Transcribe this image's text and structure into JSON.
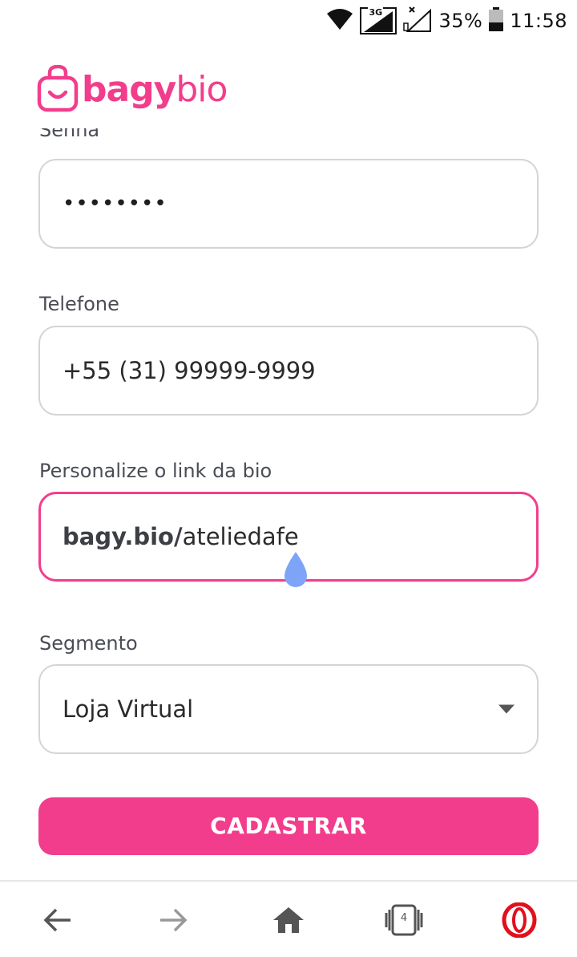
{
  "status_bar": {
    "network_label": "3G",
    "battery_percent": "35%",
    "time": "11:58",
    "icons": [
      "wifi-icon",
      "signal-icon",
      "no-signal-icon",
      "battery-icon"
    ]
  },
  "header": {
    "logo_bagy": "bagy",
    "logo_bio": "bio",
    "brand_color": "#f23d8c"
  },
  "form": {
    "password": {
      "label": "Senha",
      "value": "••••••••"
    },
    "phone": {
      "label": "Telefone",
      "value": "+55 (31) 99999-9999"
    },
    "bio_link": {
      "label": "Personalize o link da bio",
      "prefix": "bagy.bio/",
      "value": "ateliedafe"
    },
    "segment": {
      "label": "Segmento",
      "value": "Loja Virtual"
    },
    "submit_label": "CADASTRAR"
  },
  "browser_bar": {
    "tabs_count": "4",
    "icons": [
      "back-icon",
      "forward-icon",
      "home-icon",
      "tabs-icon",
      "opera-icon"
    ]
  }
}
